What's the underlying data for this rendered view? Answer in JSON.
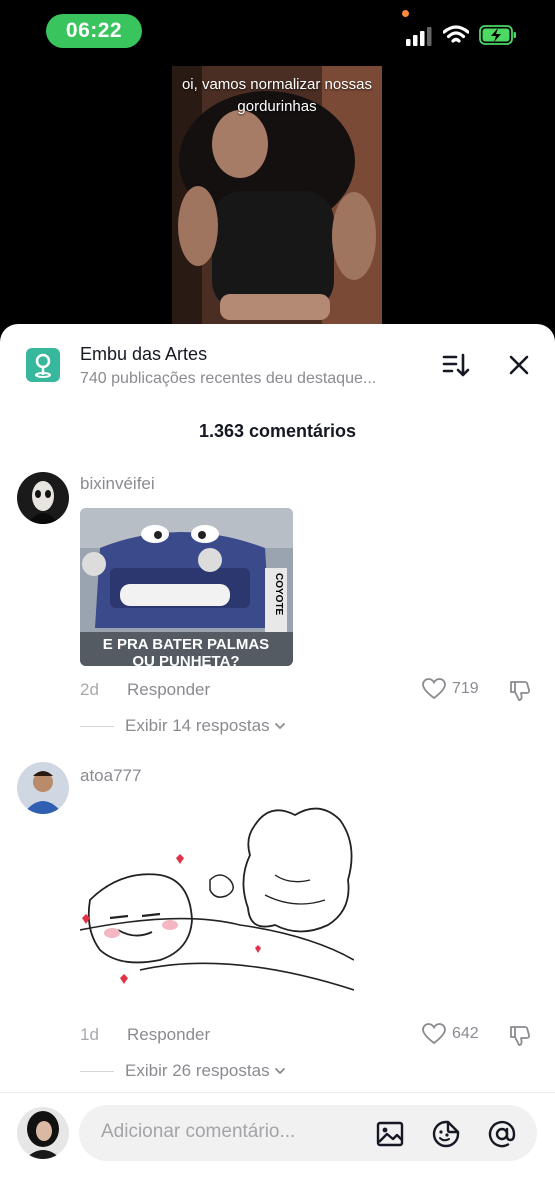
{
  "status": {
    "time": "06:22"
  },
  "video": {
    "caption_line1": "oi, vamos normalizar nossas",
    "caption_line2": "gordurinhas"
  },
  "location": {
    "title": "Embu das Artes",
    "subtitle": "740 publicações recentes deu destaque..."
  },
  "comments_header": "1.363 comentários",
  "comments": [
    {
      "username": "bixinvéifei",
      "meme_text_line1": "E PRA BATER PALMAS",
      "meme_text_line2": "OU PUNHETA?",
      "meme_side_text": "COYOTE",
      "age": "2d",
      "reply_label": "Responder",
      "likes": "719",
      "replies": "Exibir 14 respostas"
    },
    {
      "username": "atoa777",
      "age": "1d",
      "reply_label": "Responder",
      "likes": "642",
      "replies": "Exibir 26 respostas"
    }
  ],
  "input": {
    "placeholder": "Adicionar comentário..."
  },
  "colors": {
    "accent_green": "#39c45e",
    "location_icon": "#37b79c",
    "muted": "#8a8b91"
  },
  "icons": [
    "signal-icon",
    "wifi-icon",
    "battery-icon",
    "location-pin-icon",
    "sort-icon",
    "close-icon",
    "heart-icon",
    "dislike-icon",
    "chevron-down-icon",
    "image-icon",
    "sticker-icon",
    "mention-icon"
  ]
}
